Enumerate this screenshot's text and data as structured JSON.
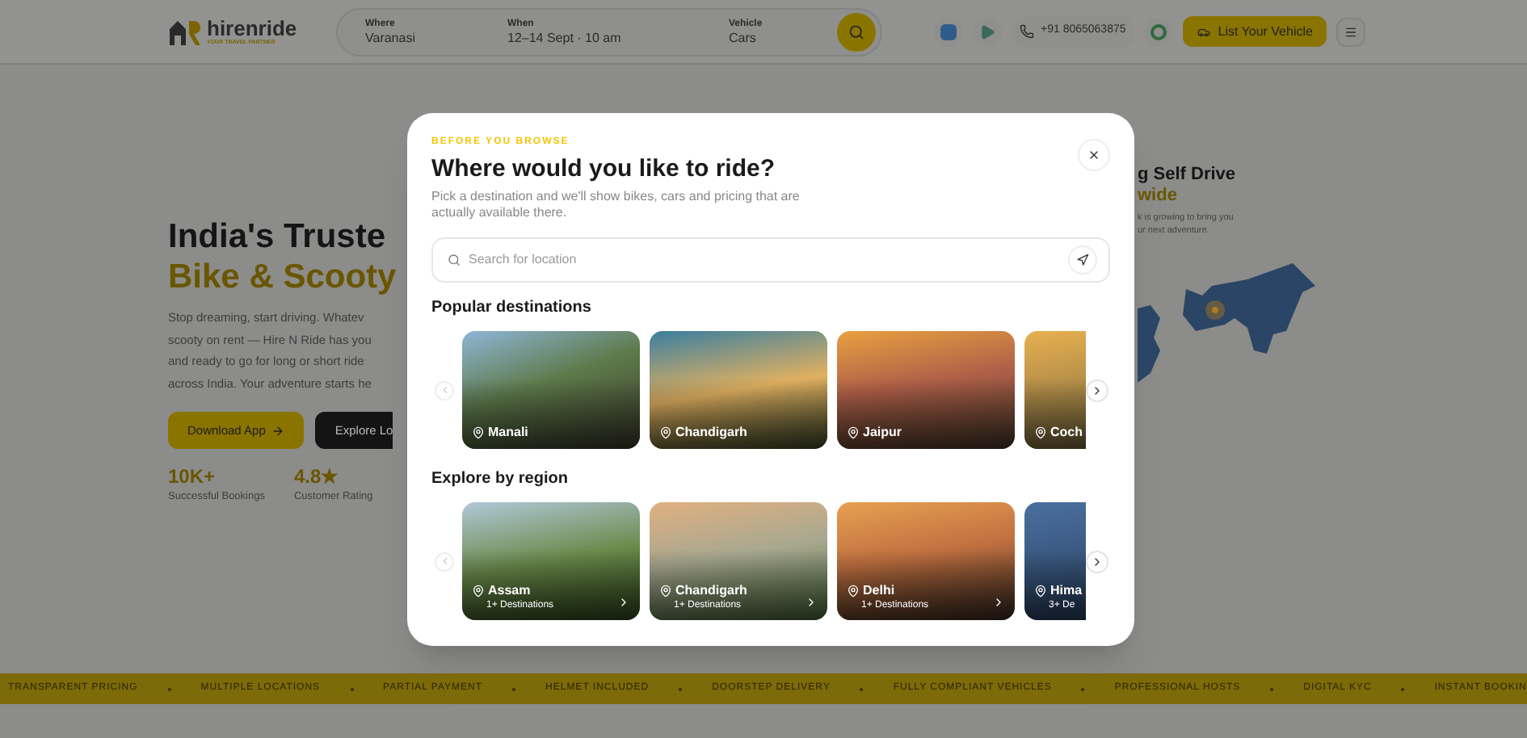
{
  "header": {
    "logo": {
      "name": "hirenride",
      "tagline": "YOUR TRAVEL PARTNER"
    },
    "search": [
      {
        "label": "Where",
        "value": "Varanasi"
      },
      {
        "label": "When",
        "value": "12–14 Sept · 10 am"
      },
      {
        "label": "Vehicle",
        "value": "Cars"
      }
    ],
    "phone": "+91 8065063875",
    "list_button": "List Your Vehicle"
  },
  "hero": {
    "title": "India's Truste",
    "title_accent": "Bike & Scooty",
    "description": [
      "Stop dreaming, start driving. Whatev",
      "scooty on rent — Hire N Ride has you",
      "and ready to go for long or short ride",
      "across India. Your adventure starts he"
    ],
    "buttons": [
      {
        "label": "Download App",
        "kind": "primary"
      },
      {
        "label": "Explore Lo",
        "kind": "dark"
      }
    ],
    "stats": [
      {
        "value": "10K+",
        "label": "Successful Bookings"
      },
      {
        "value": "4.8★",
        "label": "Customer Rating"
      }
    ]
  },
  "network": {
    "title": "g Self Drive",
    "title_accent": "wide",
    "description": [
      "k is growing to bring you",
      "ur next adventure."
    ]
  },
  "modal": {
    "eyebrow": "BEFORE YOU BROWSE",
    "title": "Where would you like to ride?",
    "subtitle": "Pick a destination and we'll show bikes, cars and pricing that are actually available there.",
    "search": {
      "placeholder": "Search for location"
    },
    "sections": [
      {
        "title": "Popular destinations",
        "cards": [
          {
            "name": "Manali"
          },
          {
            "name": "Chandigarh"
          },
          {
            "name": "Jaipur"
          },
          {
            "name": "Coch"
          }
        ]
      },
      {
        "title": "Explore by region",
        "cards": [
          {
            "name": "Assam",
            "count": "1+ Destinations"
          },
          {
            "name": "Chandigarh",
            "count": "1+ Destinations"
          },
          {
            "name": "Delhi",
            "count": "1+ Destinations"
          },
          {
            "name": "Hima",
            "count": "3+ De"
          }
        ]
      }
    ]
  },
  "ticker": [
    "TRANSPARENT PRICING",
    "MULTIPLE LOCATIONS",
    "PARTIAL PAYMENT",
    "HELMET INCLUDED",
    "DOORSTEP DELIVERY",
    "FULLY COMPLIANT VEHICLES",
    "PROFESSIONAL HOSTS",
    "DIGITAL KYC",
    "INSTANT BOOKIN"
  ]
}
